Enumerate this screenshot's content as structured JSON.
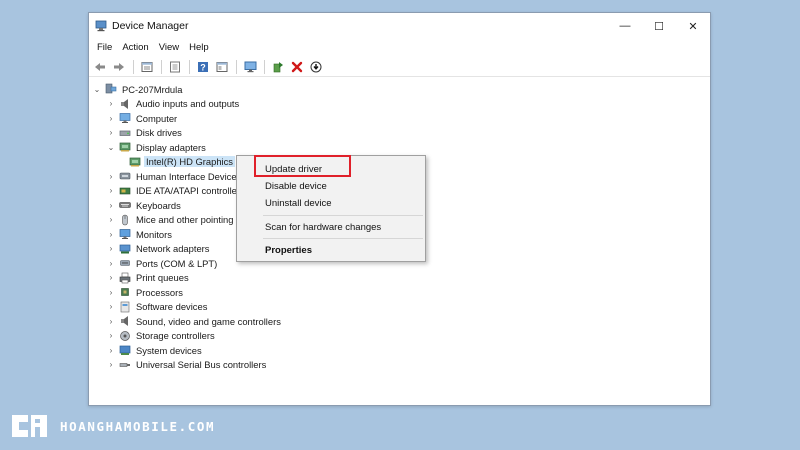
{
  "window": {
    "title": "Device Manager",
    "controls": {
      "minimize": "—",
      "maximize": "☐",
      "close": "✕"
    }
  },
  "menu": [
    "File",
    "Action",
    "View",
    "Help"
  ],
  "toolbar_icons": [
    "back-arrow-icon",
    "forward-arrow-icon",
    "properties-icon",
    "show-hide-icon",
    "help-icon",
    "view-icon",
    "monitor-icon",
    "update-driver-icon",
    "uninstall-icon",
    "download-icon"
  ],
  "tree": {
    "root": "PC-207Mrdula",
    "nodes": [
      {
        "label": "Audio inputs and outputs",
        "icon": "speaker-icon",
        "expanded": false
      },
      {
        "label": "Computer",
        "icon": "computer-icon",
        "expanded": false
      },
      {
        "label": "Disk drives",
        "icon": "disk-icon",
        "expanded": false
      },
      {
        "label": "Display adapters",
        "icon": "display-adapter-icon",
        "expanded": true
      },
      {
        "label": "Intel(R) HD Graphics",
        "icon": "display-adapter-icon",
        "child": true,
        "selected": true
      },
      {
        "label": "Human Interface Device",
        "icon": "hid-icon",
        "expanded": false
      },
      {
        "label": "IDE ATA/ATAPI controller",
        "icon": "ide-icon",
        "expanded": false
      },
      {
        "label": "Keyboards",
        "icon": "keyboard-icon",
        "expanded": false
      },
      {
        "label": "Mice and other pointing",
        "icon": "mouse-icon",
        "expanded": false
      },
      {
        "label": "Monitors",
        "icon": "monitor-icon",
        "expanded": false
      },
      {
        "label": "Network adapters",
        "icon": "network-icon",
        "expanded": false
      },
      {
        "label": "Ports (COM & LPT)",
        "icon": "port-icon",
        "expanded": false
      },
      {
        "label": "Print queues",
        "icon": "printer-icon",
        "expanded": false
      },
      {
        "label": "Processors",
        "icon": "processor-icon",
        "expanded": false
      },
      {
        "label": "Software devices",
        "icon": "software-icon",
        "expanded": false
      },
      {
        "label": "Sound, video and game controllers",
        "icon": "sound-icon",
        "expanded": false
      },
      {
        "label": "Storage controllers",
        "icon": "storage-icon",
        "expanded": false
      },
      {
        "label": "System devices",
        "icon": "system-icon",
        "expanded": false
      },
      {
        "label": "Universal Serial Bus controllers",
        "icon": "usb-icon",
        "expanded": false
      }
    ]
  },
  "context_menu": {
    "items": [
      {
        "label": "Update driver",
        "bold": false
      },
      {
        "label": "Disable device",
        "bold": false
      },
      {
        "label": "Uninstall device",
        "bold": false
      },
      {
        "label": "Scan for hardware changes",
        "bold": false
      },
      {
        "label": "Properties",
        "bold": true
      }
    ],
    "highlighted": "Update driver",
    "highlight_color": "#e0202a"
  },
  "brand": {
    "text": "HOANGHAMOBILE.COM"
  },
  "colors": {
    "background": "#a8c4df",
    "selection": "#cce4f7"
  }
}
